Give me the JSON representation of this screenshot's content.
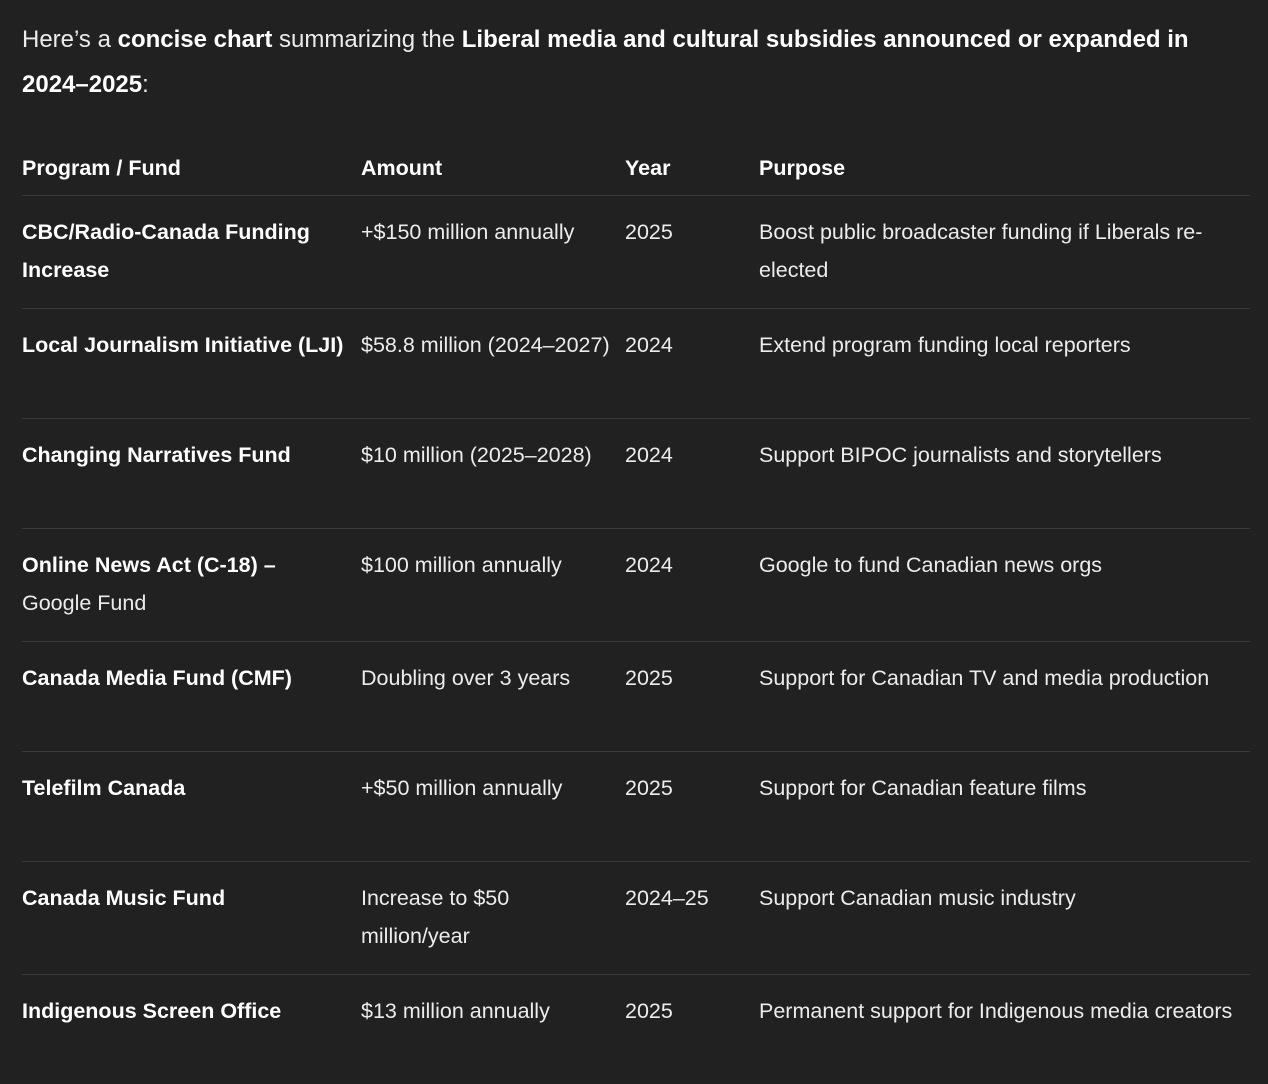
{
  "intro": {
    "part1": "Here’s a ",
    "bold1": "concise chart",
    "part2": " summarizing the ",
    "bold2": "Liberal media and cultural subsidies announced or expanded in 2024–2025",
    "part3": ":"
  },
  "table": {
    "headers": {
      "program": "Program / Fund",
      "amount": "Amount",
      "year": "Year",
      "purpose": "Purpose"
    },
    "rows": [
      {
        "program": "CBC/Radio-Canada Funding Increase",
        "program_extra": "",
        "amount": "+$150 million annually",
        "year": "2025",
        "purpose": "Boost public broadcaster funding if Liberals re-elected"
      },
      {
        "program": "Local Journalism Initiative (LJI)",
        "program_extra": "",
        "amount": "$58.8 million (2024–2027)",
        "year": "2024",
        "purpose": "Extend program funding local reporters"
      },
      {
        "program": "Changing Narratives Fund",
        "program_extra": "",
        "amount": "$10 million (2025–2028)",
        "year": "2024",
        "purpose": "Support BIPOC journalists and storytellers"
      },
      {
        "program": "Online News Act (C-18) –",
        "program_extra": "Google Fund",
        "amount": "$100 million annually",
        "year": "2024",
        "purpose": "Google to fund Canadian news orgs"
      },
      {
        "program": "Canada Media Fund (CMF)",
        "program_extra": "",
        "amount": "Doubling over 3 years",
        "year": "2025",
        "purpose": "Support for Canadian TV and media production"
      },
      {
        "program": "Telefilm Canada",
        "program_extra": "",
        "amount": "+$50 million annually",
        "year": "2025",
        "purpose": "Support for Canadian feature films"
      },
      {
        "program": "Canada Music Fund",
        "program_extra": "",
        "amount": "Increase to $50 million/year",
        "year": "2024–25",
        "purpose": "Support Canadian music industry"
      },
      {
        "program": "Indigenous Screen Office",
        "program_extra": "",
        "amount": "$13 million annually",
        "year": "2025",
        "purpose": "Permanent support for Indigenous media creators"
      }
    ]
  },
  "colors": {
    "background": "#212121",
    "text": "#ececec",
    "divider": "#3a3a3a"
  }
}
